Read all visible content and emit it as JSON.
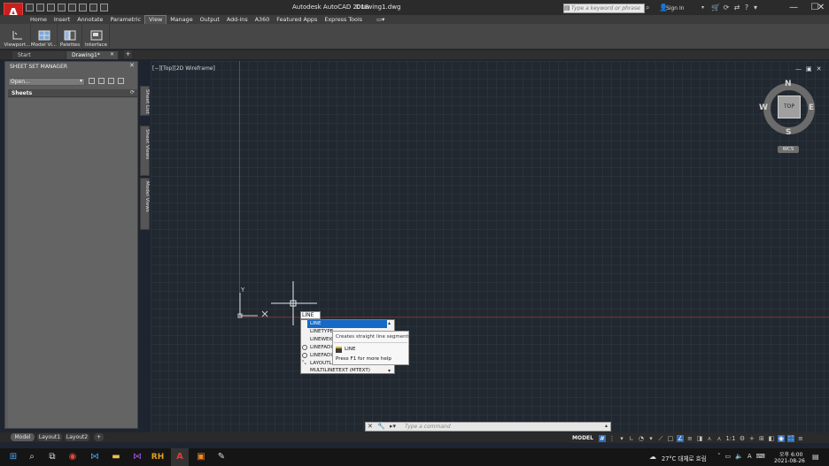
{
  "window": {
    "app_title": "Autodesk AutoCAD 2018",
    "doc_title": "Drawing1.dwg",
    "logo": "A",
    "search_placeholder": "Type a keyword or phrase",
    "signin": "Sign In",
    "controls": [
      "—",
      "☐",
      "✕"
    ]
  },
  "ribbon": {
    "tabs": [
      "Home",
      "Insert",
      "Annotate",
      "Parametric",
      "View",
      "Manage",
      "Output",
      "Add-ins",
      "A360",
      "Featured Apps",
      "Express Tools"
    ],
    "active_tab": "View",
    "buttons": [
      "Viewport...",
      "Model Vi...",
      "Palettes",
      "Interface"
    ]
  },
  "doc_tabs": [
    "Start",
    "Drawing1*"
  ],
  "sheet_set_manager": {
    "title": "SHEET SET MANAGER",
    "select_value": "Open...",
    "section": "Sheets",
    "side_tabs": [
      "Sheet List",
      "Sheet Views",
      "Model Views"
    ]
  },
  "viewport": {
    "label": "[−][Top][2D Wireframe]",
    "viewcube_face": "TOP",
    "directions": {
      "n": "N",
      "s": "S",
      "e": "E",
      "w": "W"
    },
    "wcs": "WCS",
    "ucs_y": "Y"
  },
  "autocomplete": {
    "typed": "LINE",
    "items": [
      "LINE",
      "LINETYPE",
      "LINEWEIGHT",
      "LINEFADING",
      "LINEFADINGLEVEL",
      "LAYOUTLINE",
      "MULTILINETEXT (MTEXT)"
    ],
    "selected_index": 0,
    "tooltip_desc": "Creates straight line segments",
    "tooltip_cmd": "LINE",
    "tooltip_help": "Press F1 for more help"
  },
  "command_line": {
    "placeholder": "Type a command"
  },
  "layout_tabs": [
    "Model",
    "Layout1",
    "Layout2",
    "+"
  ],
  "status": {
    "model": "MODEL",
    "scale": "1:1"
  },
  "taskbar": {
    "weather": "27°C  대체로 흐림",
    "ime": "A",
    "time": "오후 6:00",
    "date": "2021-08-26"
  },
  "colors": {
    "accent": "#1569c7",
    "logo_red": "#c8201d",
    "canvas": "#212830"
  }
}
